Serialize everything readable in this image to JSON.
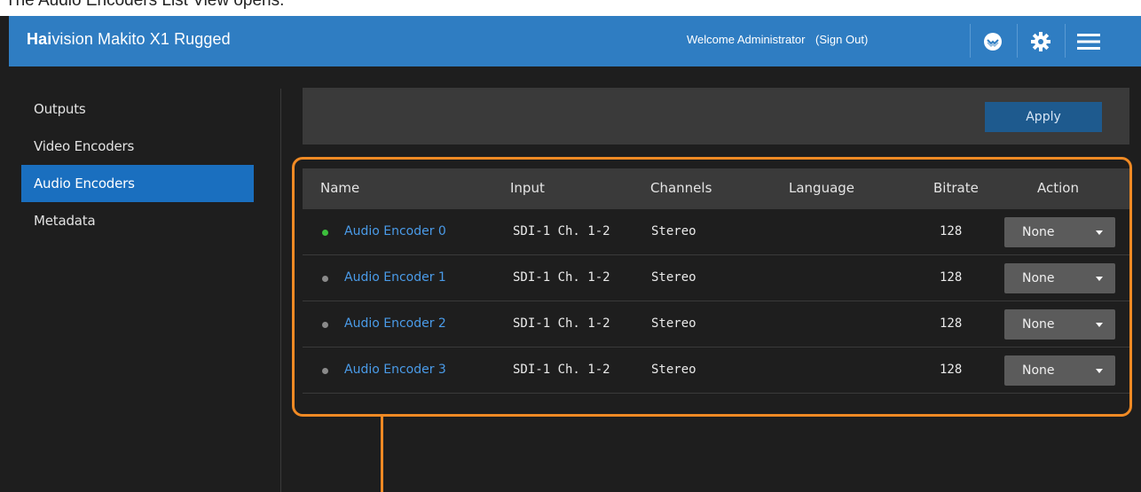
{
  "caption": "The Audio Encoders List View opens.",
  "header": {
    "brand_bold": "Hai",
    "brand_rest": "vision Makito X1 Rugged",
    "welcome": "Welcome Administrator",
    "sign_out": "(Sign Out)",
    "icons": [
      "haivision-logo-icon",
      "gear-icon",
      "hamburger-menu-icon"
    ]
  },
  "sidebar": {
    "items": [
      {
        "label": "Outputs",
        "active": false
      },
      {
        "label": "Video Encoders",
        "active": false
      },
      {
        "label": "Audio Encoders",
        "active": true
      },
      {
        "label": "Metadata",
        "active": false
      }
    ]
  },
  "toolbar": {
    "apply_label": "Apply"
  },
  "table": {
    "columns": [
      "Name",
      "Input",
      "Channels",
      "Language",
      "Bitrate",
      "Action"
    ],
    "rows": [
      {
        "name": "Audio Encoder 0",
        "input": "SDI-1 Ch. 1-2",
        "channels": "Stereo",
        "language": "",
        "bitrate": "128",
        "action": "None",
        "status": "active"
      },
      {
        "name": "Audio Encoder 1",
        "input": "SDI-1 Ch. 1-2",
        "channels": "Stereo",
        "language": "",
        "bitrate": "128",
        "action": "None",
        "status": "inactive"
      },
      {
        "name": "Audio Encoder 2",
        "input": "SDI-1 Ch. 1-2",
        "channels": "Stereo",
        "language": "",
        "bitrate": "128",
        "action": "None",
        "status": "inactive"
      },
      {
        "name": "Audio Encoder 3",
        "input": "SDI-1 Ch. 1-2",
        "channels": "Stereo",
        "language": "",
        "bitrate": "128",
        "action": "None",
        "status": "inactive"
      }
    ]
  },
  "colors": {
    "header": "#2f7dc2",
    "active_nav": "#1a6fbf",
    "link": "#4a9be8",
    "status_active": "#3cbf3c",
    "status_inactive": "#8a8a8a",
    "highlight": "#f08a24"
  }
}
